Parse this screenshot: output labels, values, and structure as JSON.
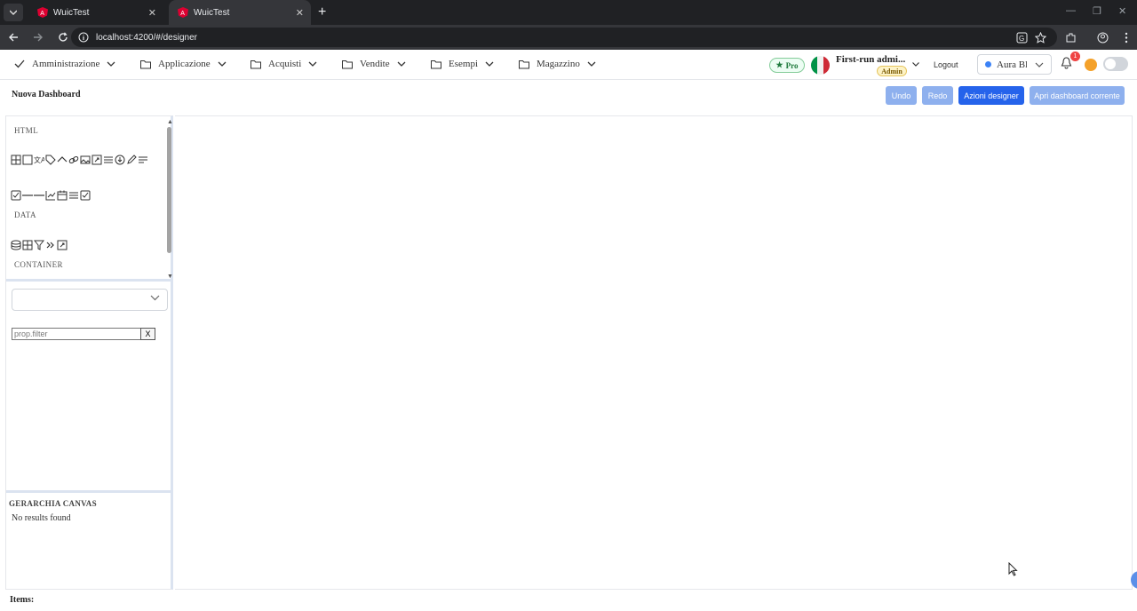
{
  "browser": {
    "tabs": [
      {
        "title": "WuicTest"
      },
      {
        "title": "WuicTest"
      }
    ],
    "url": "localhost:4200/#/designer"
  },
  "menubar": {
    "items": [
      {
        "label": "Amministrazione",
        "icon": "check-icon"
      },
      {
        "label": "Applicazione",
        "icon": "folder-icon"
      },
      {
        "label": "Acquisti",
        "icon": "folder-icon"
      },
      {
        "label": "Vendite",
        "icon": "folder-icon"
      },
      {
        "label": "Esempi",
        "icon": "folder-icon"
      },
      {
        "label": "Magazzino",
        "icon": "folder-icon"
      }
    ],
    "pro_label": "Pro",
    "user_name": "First-run admi...",
    "user_role": "Admin",
    "logout_label": "Logout",
    "theme_label": "Aura Blue",
    "notification_count": "1",
    "colors": {
      "accent": "#2563eb",
      "accent_light": "#8eb0ee",
      "badge": "#ef4444"
    }
  },
  "designer": {
    "title": "Nuova Dashboard",
    "buttons": {
      "undo": "Undo",
      "redo": "Redo",
      "actions": "Azioni designer",
      "open": "Apri dashboard corrente"
    },
    "palette": {
      "sections": [
        "HTML",
        "DATA",
        "CONTAINER"
      ]
    },
    "prop_filter_placeholder": "prop.filter",
    "prop_filter_clear": "X",
    "hierarchy_title": "GERARCHIA CANVAS",
    "hierarchy_empty": "No results found",
    "items_label": "Items:"
  }
}
